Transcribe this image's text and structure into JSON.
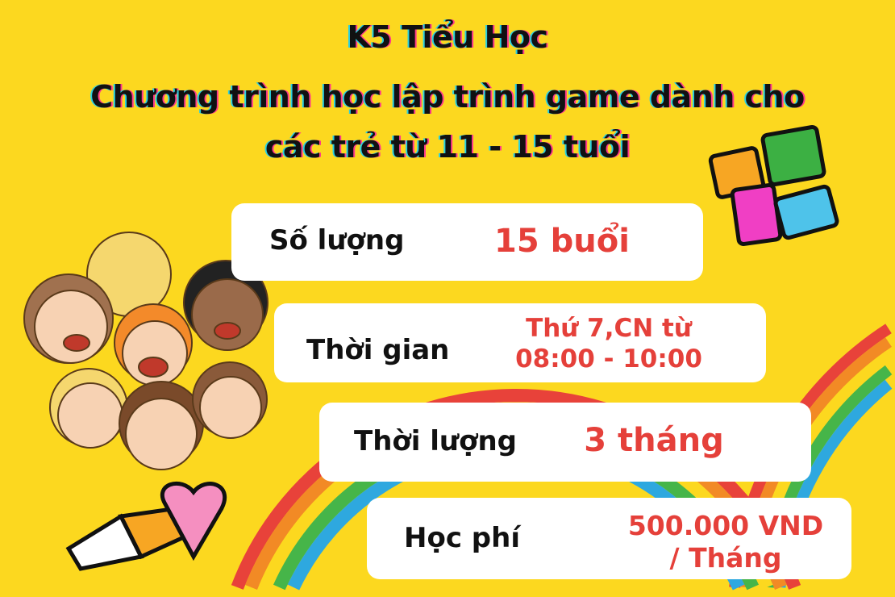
{
  "title": {
    "line1": "K5 Tiểu Học",
    "line2": "Chương trình học lập trình game dành cho",
    "line3": "các trẻ từ 11 - 15 tuổi"
  },
  "rows": [
    {
      "label": "Số lượng",
      "value": "15 buổi"
    },
    {
      "label": "Thời gian",
      "value_line1": "Thứ 7,CN từ",
      "value_line2": "08:00 - 10:00"
    },
    {
      "label": "Thời lượng",
      "value": "3 tháng"
    },
    {
      "label": "Học phí",
      "value_line1": "500.000 VND",
      "value_line2": "/ Tháng"
    }
  ],
  "colors": {
    "background": "#fcd81f",
    "value": "#e5403a",
    "label": "#111111"
  }
}
